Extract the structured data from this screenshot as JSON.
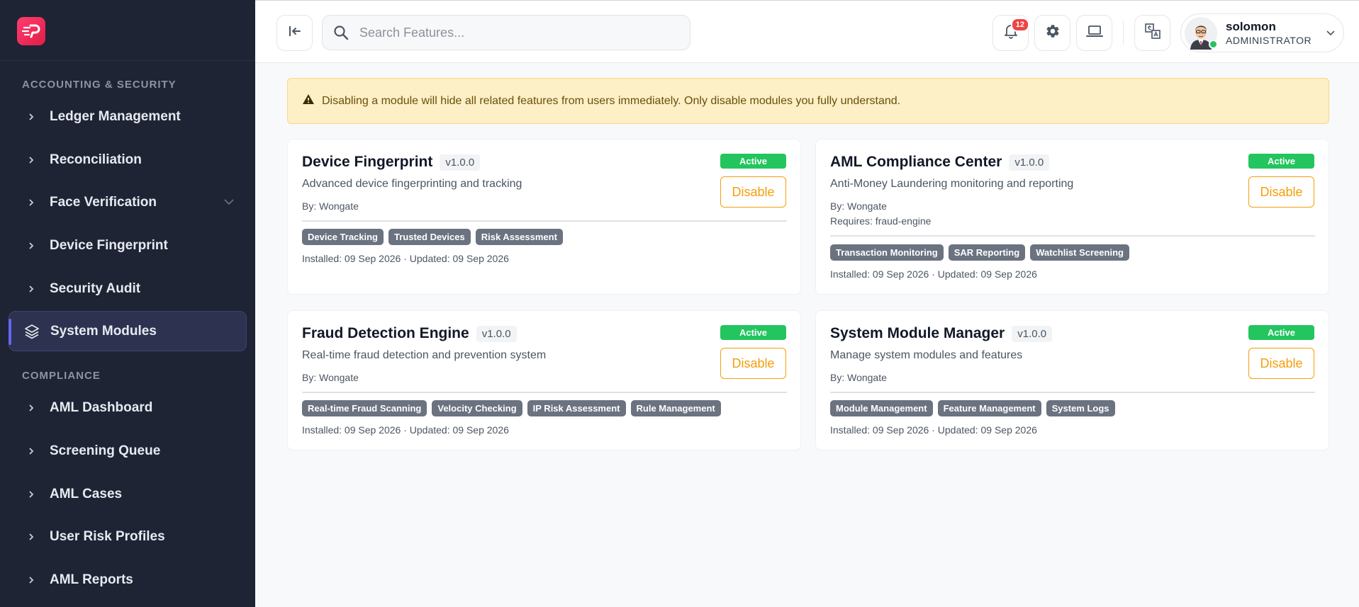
{
  "sidebar": {
    "sections": [
      {
        "title": "ACCOUNTING & SECURITY",
        "items": [
          {
            "label": "Ledger Management"
          },
          {
            "label": "Reconciliation"
          },
          {
            "label": "Face Verification"
          },
          {
            "label": "Device Fingerprint"
          },
          {
            "label": "Security Audit"
          },
          {
            "label": "System Modules",
            "active": true
          }
        ]
      },
      {
        "title": "COMPLIANCE",
        "items": [
          {
            "label": "AML Dashboard"
          },
          {
            "label": "Screening Queue"
          },
          {
            "label": "AML Cases"
          },
          {
            "label": "User Risk Profiles"
          },
          {
            "label": "AML Reports"
          }
        ]
      }
    ]
  },
  "header": {
    "search_placeholder": "Search Features...",
    "notification_count": "12",
    "user": {
      "name": "solomon",
      "role": "ADMINISTRATOR"
    }
  },
  "alert": {
    "text": "Disabling a module will hide all related features from users immediately. Only disable modules you fully understand."
  },
  "modules": [
    {
      "name": "Device Fingerprint",
      "version": "v1.0.0",
      "description": "Advanced device fingerprinting and tracking",
      "by": "By: Wongate",
      "status": "Active",
      "action": "Disable",
      "tags": [
        "Device Tracking",
        "Trusted Devices",
        "Risk Assessment"
      ],
      "dates": "Installed: 09 Sep 2026 · Updated: 09 Sep 2026"
    },
    {
      "name": "AML Compliance Center",
      "version": "v1.0.0",
      "description": "Anti-Money Laundering monitoring and reporting",
      "by": "By: Wongate",
      "requires": "Requires: fraud-engine",
      "status": "Active",
      "action": "Disable",
      "tags": [
        "Transaction Monitoring",
        "SAR Reporting",
        "Watchlist Screening"
      ],
      "dates": "Installed: 09 Sep 2026 · Updated: 09 Sep 2026"
    },
    {
      "name": "Fraud Detection Engine",
      "version": "v1.0.0",
      "description": "Real-time fraud detection and prevention system",
      "by": "By: Wongate",
      "status": "Active",
      "action": "Disable",
      "tags": [
        "Real-time Fraud Scanning",
        "Velocity Checking",
        "IP Risk Assessment",
        "Rule Management"
      ],
      "dates": "Installed: 09 Sep 2026 · Updated: 09 Sep 2026"
    },
    {
      "name": "System Module Manager",
      "version": "v1.0.0",
      "description": "Manage system modules and features",
      "by": "By: Wongate",
      "status": "Active",
      "action": "Disable",
      "tags": [
        "Module Management",
        "Feature Management",
        "System Logs"
      ],
      "dates": "Installed: 09 Sep 2026 · Updated: 09 Sep 2026"
    }
  ]
}
